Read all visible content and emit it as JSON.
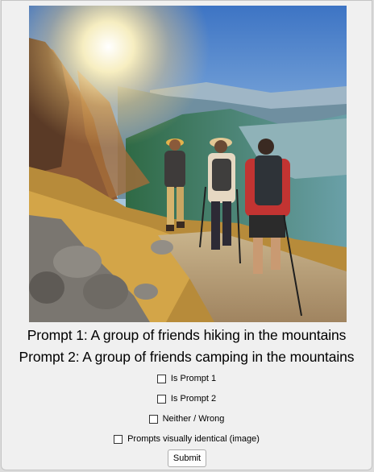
{
  "image": {
    "subject": "photo-hikers"
  },
  "prompts": {
    "prompt1": "Prompt 1: A group of friends hiking in the mountains",
    "prompt2": "Prompt 2: A group of friends camping in the mountains"
  },
  "options": [
    {
      "label": "Is Prompt 1",
      "checked": false
    },
    {
      "label": "Is Prompt 2",
      "checked": false
    },
    {
      "label": "Neither / Wrong",
      "checked": false
    },
    {
      "label": "Prompts visually identical (image)",
      "checked": false
    }
  ],
  "submit_label": "Submit"
}
